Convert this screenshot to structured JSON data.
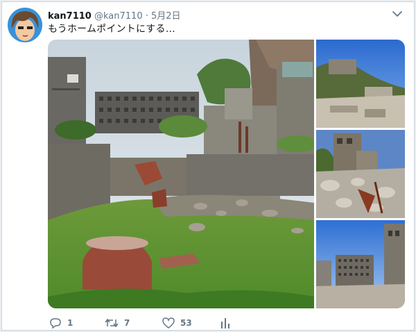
{
  "tweet": {
    "display_name": "kan7110",
    "handle": "@kan7110",
    "separator": "·",
    "date": "5月2日",
    "text": "もうホームポイントにする…"
  },
  "actions": {
    "reply_icon": "reply-icon",
    "reply_count": "1",
    "retweet_icon": "retweet-icon",
    "retweet_count": "7",
    "like_icon": "heart-icon",
    "like_count": "53",
    "stats_icon": "analytics-icon"
  },
  "media": {
    "photo_count": 4,
    "menu_icon": "chevron-down-icon"
  },
  "colors": {
    "text_primary": "#14171a",
    "text_secondary": "#657786",
    "border": "#c9d2da"
  }
}
